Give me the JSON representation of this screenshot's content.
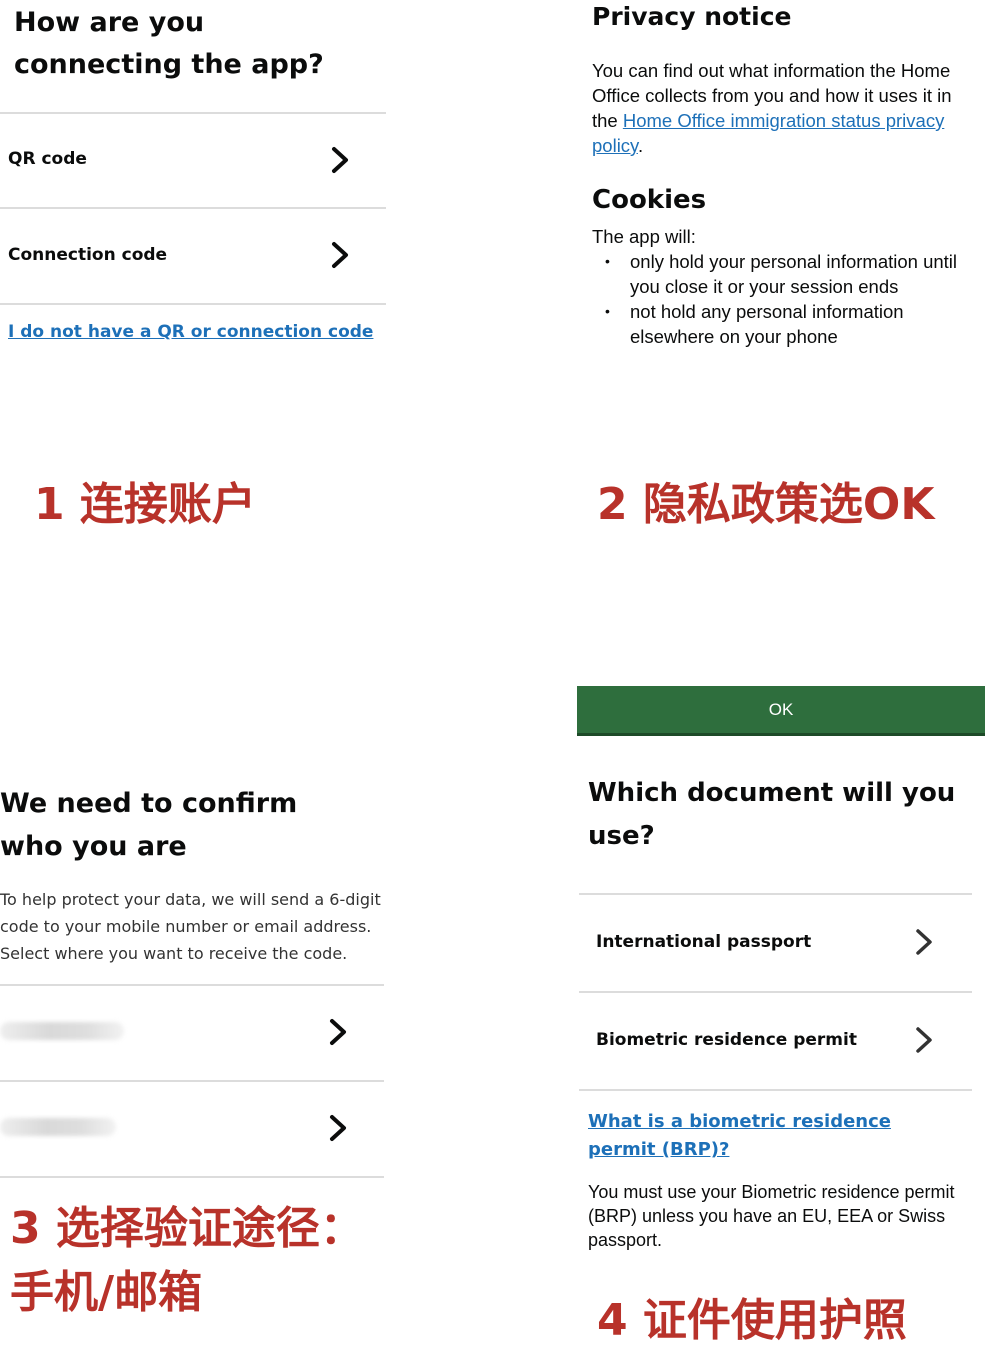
{
  "panel1": {
    "title": "How are you connecting the app?",
    "options": [
      {
        "label": "QR code"
      },
      {
        "label": "Connection code"
      }
    ],
    "no_code_link": "I do not have a QR or connection code"
  },
  "panel2": {
    "privacy_title": "Privacy notice",
    "privacy_text_before": "You can find out what information the Home Office collects from you and how it uses it in the ",
    "privacy_link": "Home Office immigration status privacy policy",
    "privacy_text_after": ".",
    "cookies_title": "Cookies",
    "cookies_intro": "The app will:",
    "cookies_items": [
      "only hold your personal information until you close it or your session ends",
      "not hold any personal information elsewhere on your phone"
    ]
  },
  "panel3": {
    "title": "We need to confirm who you are",
    "description": "To help protect your data, we will send a 6-digit code to your mobile number or email address. Select where you want to receive the code."
  },
  "panel4": {
    "ok_button": "OK",
    "title": "Which document will you use?",
    "options": [
      {
        "label": "International passport"
      },
      {
        "label": "Biometric residence permit"
      }
    ],
    "brp_link": "What is a biometric residence permit (BRP)?",
    "note": "You must use your Biometric residence permit (BRP) unless you have an EU, EEA or Swiss passport."
  },
  "annotations": {
    "step1": "1 连接账户",
    "step2": "2 隐私政策选OK",
    "step3_line1": "3 选择验证途径：",
    "step3_line2": "手机/邮箱",
    "step4": "4 证件使用护照"
  },
  "colors": {
    "link": "#1d70b8",
    "ok_button": "#2e6e3d",
    "annotation": "#b8322a",
    "divider": "#dcdcdc"
  }
}
